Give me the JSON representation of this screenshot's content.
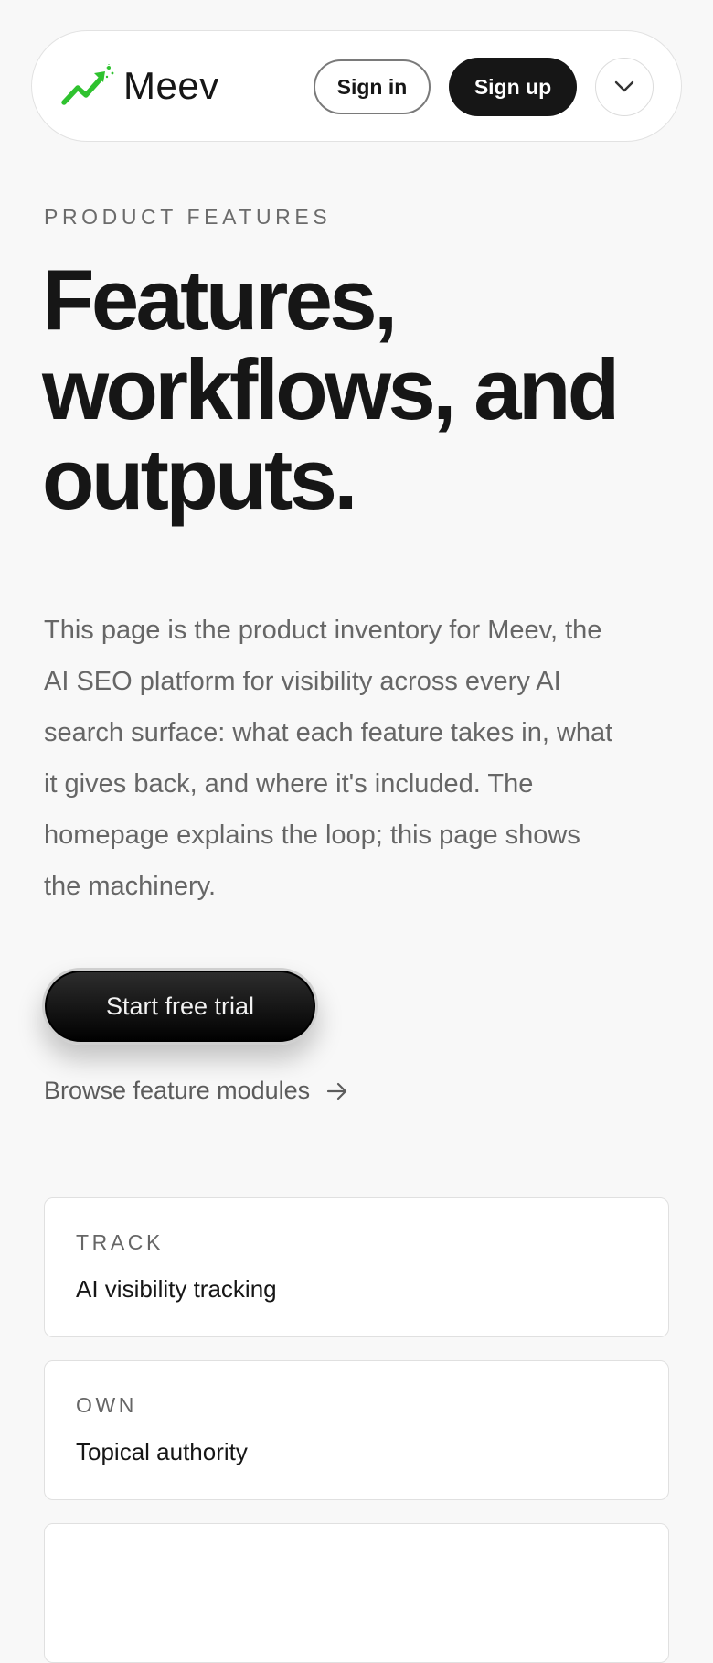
{
  "header": {
    "brand_name": "Meev",
    "sign_in_label": "Sign in",
    "sign_up_label": "Sign up",
    "menu_icon": "chevron-down-icon",
    "brand_icon": "trending-up-sparkle-icon",
    "brand_accent_color": "#2fc22f"
  },
  "hero": {
    "eyebrow": "PRODUCT FEATURES",
    "title_lines": [
      "Features,",
      "workflows, and",
      "outputs."
    ],
    "description_lines": [
      "This page is the product inventory for Meev, the",
      "AI SEO platform for visibility across every AI",
      "search surface: what each feature takes in, what",
      "it gives back, and where it's included. The",
      "homepage explains the loop; this page shows",
      "the machinery."
    ],
    "cta_label": "Start free trial",
    "secondary_link_label": "Browse feature modules",
    "secondary_link_icon": "arrow-right-icon"
  },
  "modules": [
    {
      "label": "TRACK",
      "title": "AI visibility tracking"
    },
    {
      "label": "OWN",
      "title": "Topical authority"
    }
  ],
  "colors": {
    "background": "#f8f8f8",
    "primary": "#161616",
    "muted_text": "#666666"
  }
}
